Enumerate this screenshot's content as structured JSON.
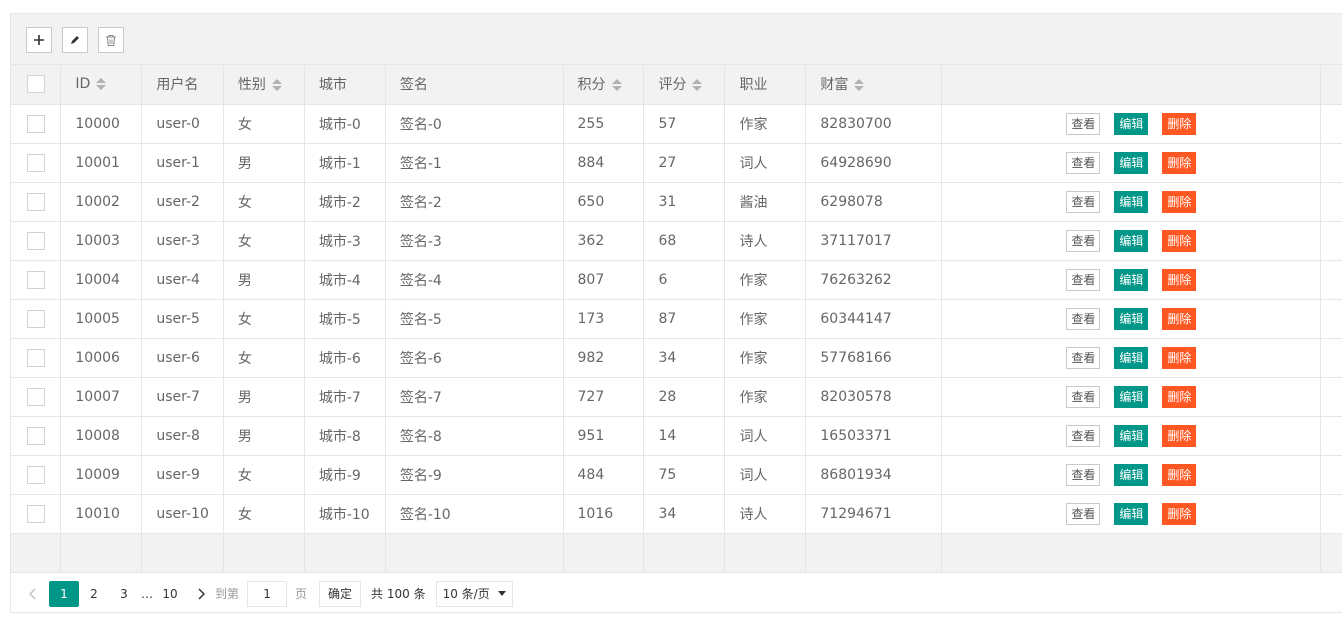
{
  "toolbar": {
    "add_icon": "plus-icon",
    "edit_icon": "pencil-icon",
    "delete_icon": "trash-icon"
  },
  "columns": {
    "id": "ID",
    "username": "用户名",
    "sex": "性别",
    "city": "城市",
    "sign": "签名",
    "score": "积分",
    "rating": "评分",
    "job": "职业",
    "wealth": "财富"
  },
  "rows": [
    {
      "id": "10000",
      "username": "user-0",
      "sex": "女",
      "city": "城市-0",
      "sign": "签名-0",
      "score": "255",
      "rating": "57",
      "job": "作家",
      "wealth": "82830700"
    },
    {
      "id": "10001",
      "username": "user-1",
      "sex": "男",
      "city": "城市-1",
      "sign": "签名-1",
      "score": "884",
      "rating": "27",
      "job": "词人",
      "wealth": "64928690"
    },
    {
      "id": "10002",
      "username": "user-2",
      "sex": "女",
      "city": "城市-2",
      "sign": "签名-2",
      "score": "650",
      "rating": "31",
      "job": "酱油",
      "wealth": "6298078"
    },
    {
      "id": "10003",
      "username": "user-3",
      "sex": "女",
      "city": "城市-3",
      "sign": "签名-3",
      "score": "362",
      "rating": "68",
      "job": "诗人",
      "wealth": "37117017"
    },
    {
      "id": "10004",
      "username": "user-4",
      "sex": "男",
      "city": "城市-4",
      "sign": "签名-4",
      "score": "807",
      "rating": "6",
      "job": "作家",
      "wealth": "76263262"
    },
    {
      "id": "10005",
      "username": "user-5",
      "sex": "女",
      "city": "城市-5",
      "sign": "签名-5",
      "score": "173",
      "rating": "87",
      "job": "作家",
      "wealth": "60344147"
    },
    {
      "id": "10006",
      "username": "user-6",
      "sex": "女",
      "city": "城市-6",
      "sign": "签名-6",
      "score": "982",
      "rating": "34",
      "job": "作家",
      "wealth": "57768166"
    },
    {
      "id": "10007",
      "username": "user-7",
      "sex": "男",
      "city": "城市-7",
      "sign": "签名-7",
      "score": "727",
      "rating": "28",
      "job": "作家",
      "wealth": "82030578"
    },
    {
      "id": "10008",
      "username": "user-8",
      "sex": "男",
      "city": "城市-8",
      "sign": "签名-8",
      "score": "951",
      "rating": "14",
      "job": "词人",
      "wealth": "16503371"
    },
    {
      "id": "10009",
      "username": "user-9",
      "sex": "女",
      "city": "城市-9",
      "sign": "签名-9",
      "score": "484",
      "rating": "75",
      "job": "词人",
      "wealth": "86801934"
    },
    {
      "id": "10010",
      "username": "user-10",
      "sex": "女",
      "city": "城市-10",
      "sign": "签名-10",
      "score": "1016",
      "rating": "34",
      "job": "诗人",
      "wealth": "71294671"
    }
  ],
  "row_actions": {
    "view": "查看",
    "edit": "编辑",
    "delete": "删除"
  },
  "pager": {
    "pages": [
      "1",
      "2",
      "3"
    ],
    "ellipsis": "…",
    "last_page": "10",
    "goto_label": "到第",
    "goto_value": "1",
    "page_unit": "页",
    "confirm": "确定",
    "total": "共 100 条",
    "page_size": "10 条/页"
  },
  "colors": {
    "primary": "#009688",
    "danger": "#ff5722",
    "header_bg": "#f2f2f2",
    "border": "#e6e6e6"
  }
}
